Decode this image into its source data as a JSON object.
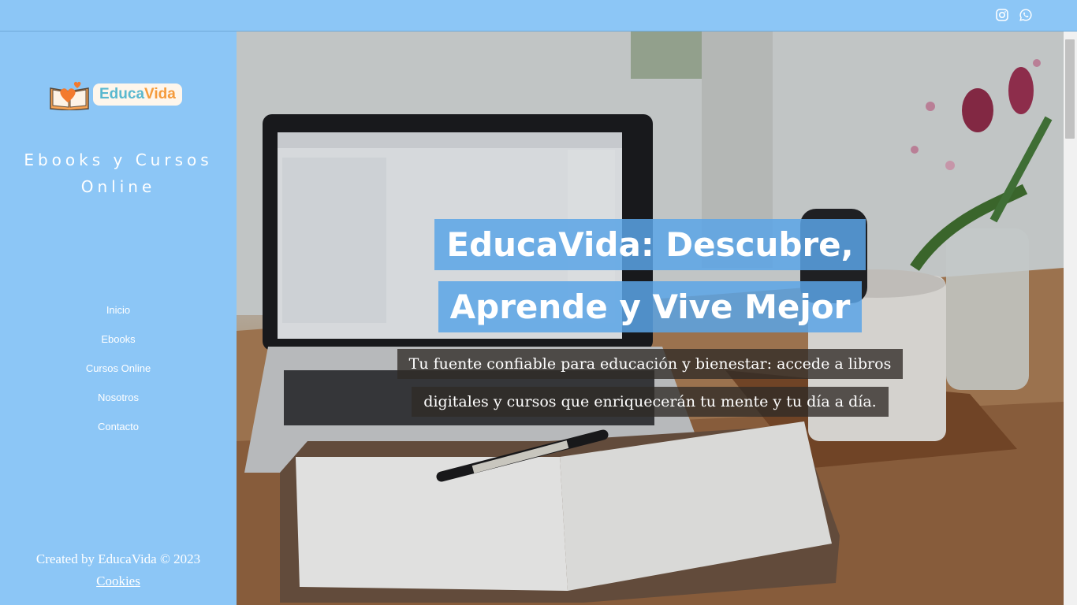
{
  "topbar": {
    "icons": [
      "instagram-icon",
      "whatsapp-icon"
    ]
  },
  "sidebar": {
    "logo": {
      "part1": "Educa",
      "part2": "Vida"
    },
    "tagline": [
      "Ebooks y Cursos",
      "Online"
    ],
    "nav": [
      {
        "label": "Inicio"
      },
      {
        "label": "Ebooks"
      },
      {
        "label": "Cursos Online"
      },
      {
        "label": "Nosotros"
      },
      {
        "label": "Contacto"
      }
    ],
    "credit": "Created by EducaVida © 2023",
    "cookies": "Cookies"
  },
  "hero": {
    "title_lines": [
      "EducaVida: Descubre,",
      "Aprende y Vive Mejor"
    ],
    "subtitle_lines": [
      "Tu fuente confiable para educación y bienestar: accede a libros",
      "digitales y cursos que enriquecerán tu mente y tu día a día."
    ]
  },
  "colors": {
    "sidebar_bg": "#8cc6f6",
    "title_bg": "#5aa5e6",
    "logo_teal": "#5ab8cf",
    "logo_orange": "#f59b3c"
  }
}
